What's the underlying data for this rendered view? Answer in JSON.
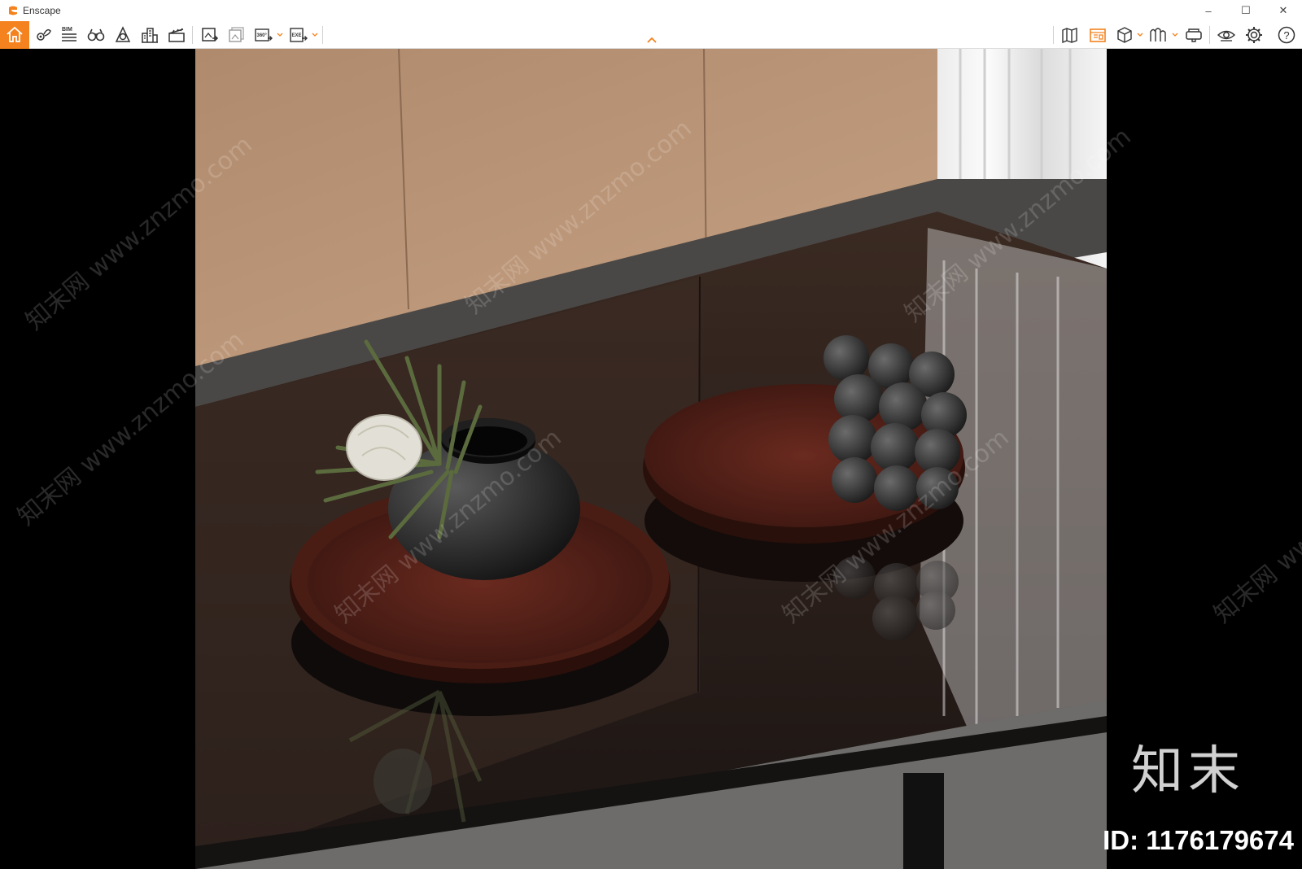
{
  "window": {
    "title": "Enscape",
    "brand_color": "#f4821e",
    "minimize_glyph": "–",
    "maximize_glyph": "☐",
    "close_glyph": "✕"
  },
  "toolbar": {
    "left_buttons": [
      {
        "name": "home-icon",
        "active": true
      },
      {
        "name": "pin-icon"
      },
      {
        "name": "bim-icon",
        "label": "BIM"
      },
      {
        "name": "binoculars-icon"
      },
      {
        "name": "compass-icon"
      },
      {
        "name": "buildings-icon"
      },
      {
        "name": "clapper-icon"
      },
      {
        "name": "render-screenshot-icon"
      },
      {
        "name": "batch-render-icon"
      },
      {
        "name": "panorama-360-icon",
        "label": "360°"
      },
      {
        "name": "export-exe-icon",
        "label": "EXE"
      }
    ],
    "right_buttons": [
      {
        "name": "map-icon"
      },
      {
        "name": "asset-library-icon"
      },
      {
        "name": "cube-view-icon"
      },
      {
        "name": "materials-icon"
      },
      {
        "name": "vr-headset-icon"
      },
      {
        "name": "eye-visibility-icon"
      },
      {
        "name": "gear-icon"
      },
      {
        "name": "help-icon",
        "label": "?"
      }
    ]
  },
  "watermark": {
    "text": "知末网 www.znzmo.com",
    "logo": "知末",
    "id": "ID: 1176179674"
  }
}
